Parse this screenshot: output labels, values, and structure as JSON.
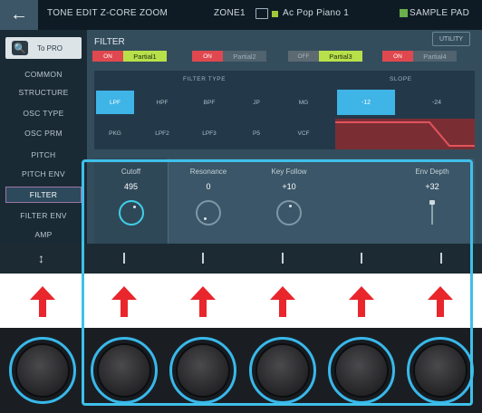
{
  "header": {
    "title": "TONE EDIT Z-CORE ZOOM",
    "zone": "ZONE1",
    "tone_name": "Ac Pop Piano 1",
    "sample_pad": "SAMPLE PAD"
  },
  "sidebar": {
    "to_pro": "To PRO",
    "items": [
      {
        "label": "COMMON"
      },
      {
        "label": "STRUCTURE"
      },
      {
        "label": "OSC TYPE"
      },
      {
        "label": "OSC PRM"
      },
      {
        "label": "PITCH"
      },
      {
        "label": "PITCH ENV"
      },
      {
        "label": "FILTER"
      },
      {
        "label": "FILTER ENV"
      },
      {
        "label": "AMP"
      }
    ],
    "active_index": 6
  },
  "filter": {
    "title": "FILTER",
    "utility": "UTILITY",
    "partials": [
      {
        "switch": "ON",
        "name": "Partial1",
        "on": true
      },
      {
        "switch": "ON",
        "name": "Partial2",
        "on": true
      },
      {
        "switch": "OFF",
        "name": "Partial3",
        "on": false
      },
      {
        "switch": "ON",
        "name": "Partial4",
        "on": true
      }
    ],
    "filter_type_label": "FILTER TYPE",
    "slope_label": "SLOPE",
    "types_row1": [
      "LPF",
      "HPF",
      "BPF",
      "JP",
      "MG"
    ],
    "types_row2": [
      "PKG",
      "LPF2",
      "LPF3",
      "P5",
      "VCF"
    ],
    "selected_type": "LPF",
    "slopes": [
      "-12",
      "-24"
    ],
    "selected_slope": "-12"
  },
  "params": [
    {
      "label": "Cutoff",
      "value": "495"
    },
    {
      "label": "Resonance",
      "value": "0"
    },
    {
      "label": "Key Follow",
      "value": "+10"
    },
    {
      "label": "Env Depth",
      "value": "+32"
    }
  ],
  "colors": {
    "accent_cyan": "#3fb4e6",
    "arrow_red": "#e8262b",
    "partial_green": "#b8e04a",
    "switch_red": "#e0484f"
  }
}
